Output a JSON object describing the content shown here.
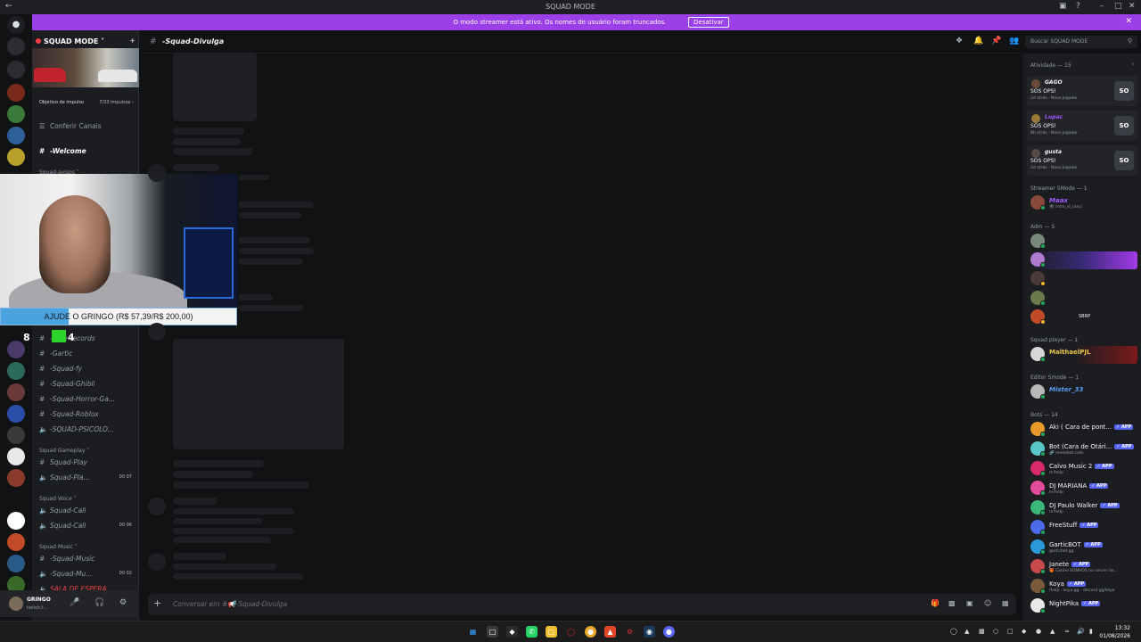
{
  "window": {
    "title": "SQUAD MODE",
    "back": "←",
    "controls": [
      "▣",
      "?",
      "–",
      "□",
      "✕"
    ]
  },
  "streamer_banner": {
    "message": "O modo streamer está ativo. Os nomes de usuário foram truncados.",
    "button": "Desativar",
    "close": "✕"
  },
  "server": {
    "name": "SQUAD MODE ˅",
    "boost_label": "Objetivo de impulso",
    "boost_count": "7/33 Impulsos ›",
    "browse": "Conferir Canais",
    "channels": [
      {
        "name": "-Welcome",
        "prefix": "#",
        "active": true
      },
      {
        "name": "Squad-avisos ˅",
        "prefix": "",
        "category": true
      }
    ]
  },
  "channel_list_lower": [
    {
      "name": "-rede-records",
      "prefix": "#"
    },
    {
      "name": "-Gartic",
      "prefix": "#"
    },
    {
      "name": "-Squad-fy",
      "prefix": "#"
    },
    {
      "name": "-Squad-Ghibli",
      "prefix": "#"
    },
    {
      "name": "-Squad-Horror-Ga...",
      "prefix": "#"
    },
    {
      "name": "-Squad-Roblox",
      "prefix": "#"
    },
    {
      "name": "-SQUAD-PSICOLO...",
      "prefix": "🔈"
    }
  ],
  "categories": {
    "gameplay": "Squad Gameplay ˅",
    "voice": "Squad Voice ˅",
    "music": "Squad Music ˅"
  },
  "gameplay_channels": [
    {
      "name": "Squad-Play",
      "prefix": "#",
      "count": ""
    },
    {
      "name": "Squad-Pla...",
      "prefix": "🔈",
      "count": "00 07"
    }
  ],
  "voice_channels": [
    {
      "name": "Squad-Call",
      "prefix": "🔈",
      "count": ""
    },
    {
      "name": "Squad-Call",
      "prefix": "🔈",
      "count": "00 06"
    }
  ],
  "music_channels": [
    {
      "name": "-Squad-Music",
      "prefix": "#",
      "count": ""
    },
    {
      "name": "-Squad-Mu...",
      "prefix": "🔈",
      "count": "00 02"
    },
    {
      "name": "SALA DE ESPERA",
      "prefix": "🔈",
      "count": ""
    }
  ],
  "overlay": {
    "donation_text": "AJUDE O GRINGO (R$ 57,39/R$ 200,00)",
    "donation_progress": 0.287,
    "badge_a": "8",
    "badge_b": "4"
  },
  "user": {
    "name": "GRINGO",
    "status": "twitch.t..."
  },
  "chat": {
    "channel_name": "-Squad-Divulga",
    "placeholder": "Conversar em #📢-Squad-Divulga",
    "search_placeholder": "Buscar SQUAD MODE"
  },
  "members": {
    "activity_header": "Atividade — 15",
    "activities": [
      {
        "name": "GAGO",
        "title": "SOS OPS!",
        "meta": "2d atrás  · Novo Jogador",
        "icon": "SO"
      },
      {
        "name": "Lupac",
        "title": "SOS OPS!",
        "meta": "8h atrás  · Novo Jogador",
        "icon": "SO"
      },
      {
        "name": "gusta",
        "title": "SOS OPS!",
        "meta": "2d atrás  · Novo Jogador",
        "icon": "SO"
      }
    ],
    "groups": [
      {
        "title": "Streamer SMode — 1",
        "members": [
          {
            "name": "Maax",
            "sub": "👁 /vtm_vl_ranci",
            "color": "#a259ff"
          }
        ]
      },
      {
        "title": "Adm — 5",
        "members": [
          {
            "name": "",
            "sub": "",
            "color": "#f2f3f5"
          },
          {
            "name": "",
            "sub": "",
            "color": "#f2f3f5"
          },
          {
            "name": "",
            "sub": "",
            "color": "#f2f3f5"
          },
          {
            "name": "",
            "sub": "",
            "color": "#f2f3f5"
          },
          {
            "name": "SBRP",
            "sub": "",
            "color": "#f2f3f5"
          }
        ]
      },
      {
        "title": "Squad player — 1",
        "members": [
          {
            "name": "MalthaelPJL",
            "sub": "",
            "color": "#e8c547"
          }
        ]
      },
      {
        "title": "Editor Smode — 1",
        "members": [
          {
            "name": "Mister_33",
            "sub": "",
            "color": "#5b9cf5"
          }
        ]
      },
      {
        "title": "Bots — 14",
        "members": []
      }
    ],
    "bots": [
      {
        "name": "Aki ( Cara de pont...",
        "sub": ""
      },
      {
        "name": "Bot (Cara de Otári...",
        "sub": "🔗 meeebot.com"
      },
      {
        "name": "Calvo Music 2",
        "sub": "m!help"
      },
      {
        "name": "DJ MARIANA",
        "sub": "m!help"
      },
      {
        "name": "DJ Paulo Walker",
        "sub": "m!help"
      },
      {
        "name": "FreeStuff",
        "sub": ""
      },
      {
        "name": "GarticBOT",
        "sub": "garticbot.gg"
      },
      {
        "name": "Janete",
        "sub": "🎁 Ganhe SONHOS no server de..."
      },
      {
        "name": "Koya",
        "sub": "/help - koya.gg - discord.gg/koya"
      },
      {
        "name": "NightPika",
        "sub": ""
      }
    ],
    "app_badge": "✓ APP"
  },
  "taskbar": {
    "time": "13:32",
    "date": "01/08/2026"
  },
  "colors": {
    "banner": "#9b3fe8",
    "accent": "#5865f2",
    "online": "#23a55a"
  }
}
